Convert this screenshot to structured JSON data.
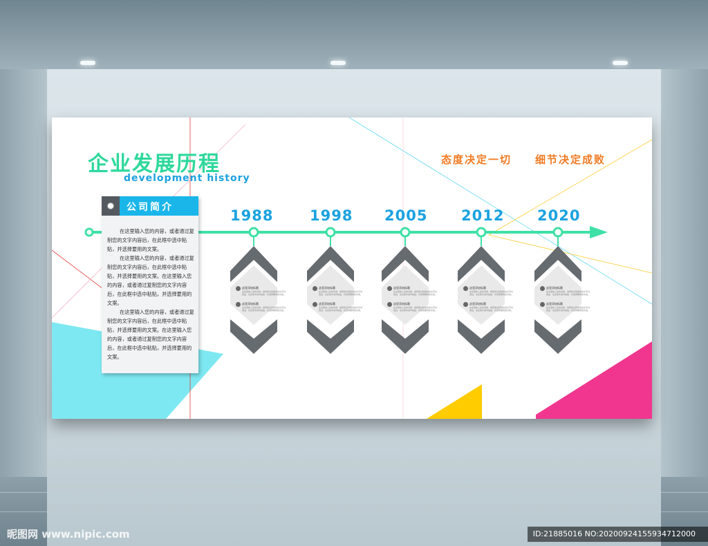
{
  "board": {
    "title_cn": "企业发展历程",
    "title_en": "development history",
    "slogan_left": "态度决定一切",
    "slogan_right": "细节决定成败"
  },
  "intro": {
    "heading": "公司简介",
    "paragraphs": [
      "在这里输入您的内容，或者通过复制您的文字内容后，在此框中选中粘贴，并选择要用的文案。",
      "在这里输入您的内容，或者通过复制您的文字内容后，在此框中选中粘贴，并选择要用的文案。在这里输入您的内容，或者通过复制您的文字内容后，在此框中选中粘贴，并选择要用的文案。",
      "在这里输入您的内容，或者通过复制您的文字内容后，在此框中选中粘贴，并选择要用的文案。在这里输入您的内容，或者通过复制您的文字内容后，在此框中选中粘贴，并选择要用的文案。"
    ]
  },
  "timeline": {
    "years": [
      "1988",
      "1998",
      "2005",
      "2012",
      "2020"
    ],
    "card_row_title": "这里添加标题",
    "card_row_text": "在这里输入您的内容，或者通过复制您的文字内容后，在此框中选中粘贴，并选择要用的文案。"
  },
  "watermark": {
    "left": "昵图网 www.nipic.com",
    "right": "ID:21885016 NO:20200924155934712000"
  },
  "colors": {
    "green": "#2ed89c",
    "blue": "#1aa2e0",
    "orange": "#f07a22",
    "cyan": "#7ee8f2",
    "pink": "#f0368e",
    "yellow": "#ffcc00",
    "gray": "#666b70"
  }
}
